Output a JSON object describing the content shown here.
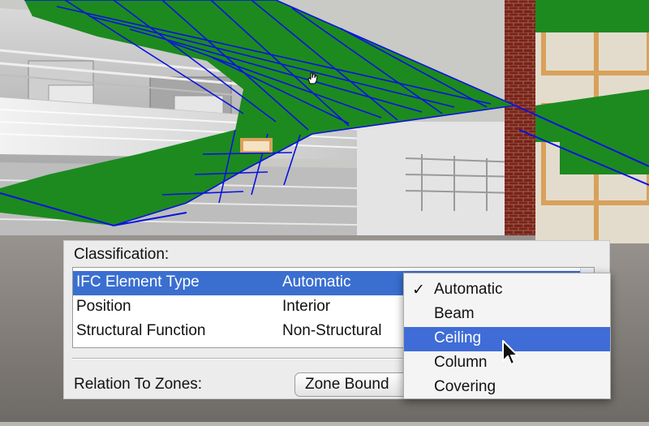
{
  "panel": {
    "classification_label": "Classification:",
    "relation_label": "Relation To Zones:",
    "zone_button_text": "Zone Bound"
  },
  "classification_rows": [
    {
      "name": "IFC Element Type",
      "value": "Automatic",
      "selected": true
    },
    {
      "name": "Position",
      "value": "Interior",
      "selected": false
    },
    {
      "name": "Structural Function",
      "value": "Non-Structural",
      "selected": false
    }
  ],
  "dropdown": {
    "options": [
      "Automatic",
      "Beam",
      "Ceiling",
      "Column",
      "Covering"
    ],
    "checked": "Automatic",
    "highlighted": "Ceiling",
    "check_glyph": "✓"
  },
  "colors": {
    "selection_blue": "#3a6fd0",
    "menu_highlight": "#3f6cd6",
    "mesh_green": "#1d8a1f",
    "mesh_blue_lines": "#0a12e0",
    "brick": "#7a2317",
    "timber": "#d9a15a"
  },
  "icons": [
    "checkmark-icon",
    "arrow-cursor-icon",
    "hand-cursor-icon"
  ]
}
